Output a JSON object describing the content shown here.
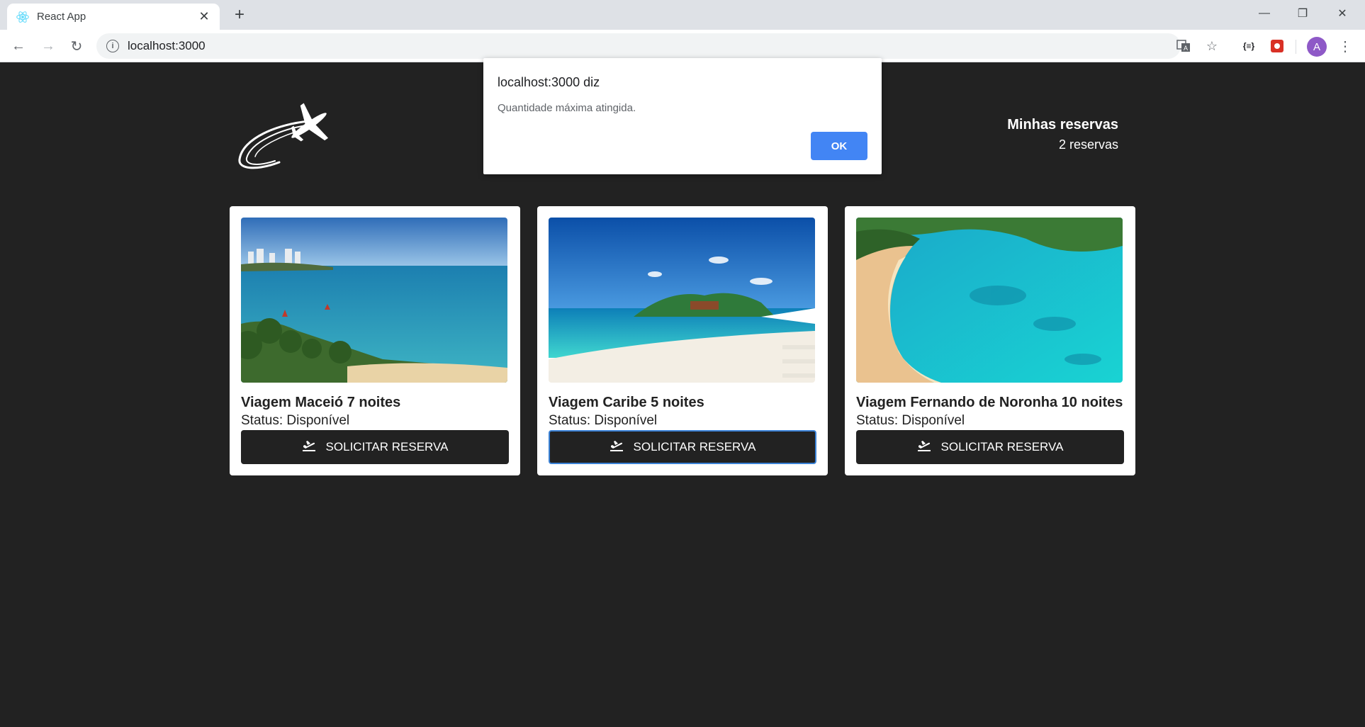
{
  "browser": {
    "tab_title": "React App",
    "url": "localhost:3000",
    "avatar_letter": "A"
  },
  "header": {
    "reservas_title": "Minhas reservas",
    "reservas_count": "2 reservas"
  },
  "trips": [
    {
      "title": "Viagem Maceió 7 noites",
      "status": "Status: Disponível",
      "button": "SOLICITAR RESERVA"
    },
    {
      "title": "Viagem Caribe 5 noites",
      "status": "Status: Disponível",
      "button": "SOLICITAR RESERVA"
    },
    {
      "title": "Viagem Fernando de Noronha 10 noites",
      "status": "Status: Disponível",
      "button": "SOLICITAR RESERVA"
    }
  ],
  "dialog": {
    "title": "localhost:3000 diz",
    "message": "Quantidade máxima atingida.",
    "ok": "OK"
  },
  "colors": {
    "page_background": "#222222",
    "card_background": "#ffffff",
    "button_background": "#222222",
    "dialog_ok": "#4285f4"
  }
}
